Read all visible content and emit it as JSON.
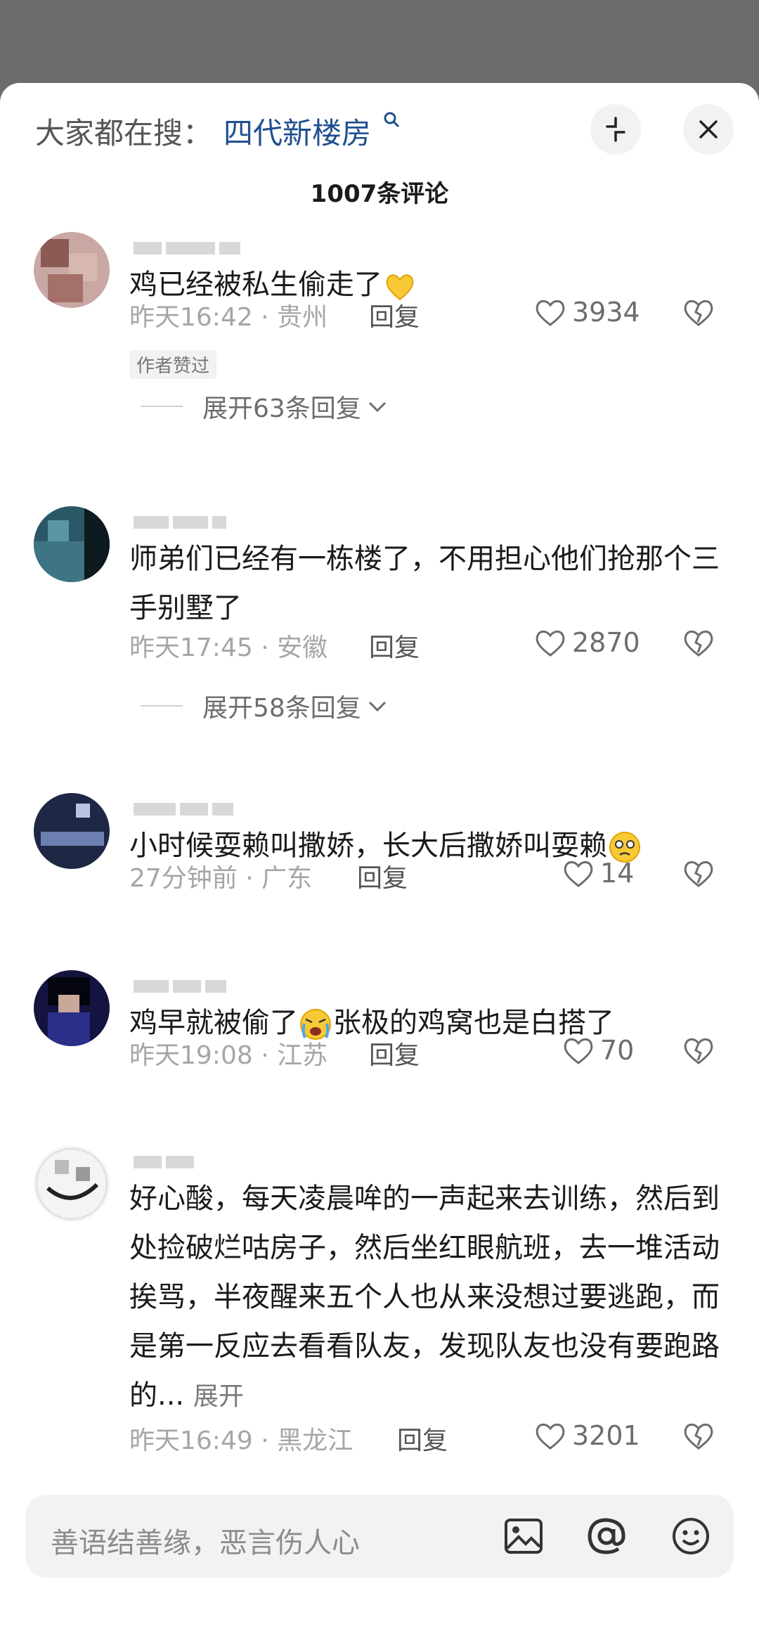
{
  "header": {
    "search_prefix": "大家都在搜：",
    "search_term": "四代新楼房",
    "title": "1007条评论"
  },
  "comments": [
    {
      "text": "鸡已经被私生偷走了",
      "emoji": "heart-hands",
      "time_location": "昨天16:42 · 贵州",
      "reply_label": "回复",
      "likes": "3934",
      "badge": "作者赞过",
      "expand": "展开63条回复"
    },
    {
      "text": "师弟们已经有一栋楼了，不用担心他们抢那个三手别墅了",
      "time_location": "昨天17:45 · 安徽",
      "reply_label": "回复",
      "likes": "2870",
      "expand": "展开58条回复"
    },
    {
      "text": "小时候耍赖叫撒娇，长大后撒娇叫耍赖",
      "emoji": "teary-face",
      "time_location": "27分钟前 · 广东",
      "reply_label": "回复",
      "likes": "14"
    },
    {
      "text_before": "鸡早就被偷了",
      "text_after": "张极的鸡窝也是白搭了",
      "emoji": "crying-face",
      "time_location": "昨天19:08 · 江苏",
      "reply_label": "回复",
      "likes": "70"
    },
    {
      "text": "好心酸，每天凌晨哞的一声起来去训练，然后到处捡破烂咕房子，然后坐红眼航班，去一堆活动挨骂，半夜醒来五个人也从来没想过要逃跑，而是第一反应去看看队友，发现队友也没有要跑路的...",
      "more_label": "展开",
      "time_location": "昨天16:49 · 黑龙江",
      "reply_label": "回复",
      "likes": "3201"
    }
  ],
  "input": {
    "placeholder": "善语结善缘，恶言伤人心"
  },
  "colors": {
    "search_term": "#1f4f8f",
    "meta_text": "#a6a6a6",
    "overlay_bg": "#6b6b6b"
  }
}
